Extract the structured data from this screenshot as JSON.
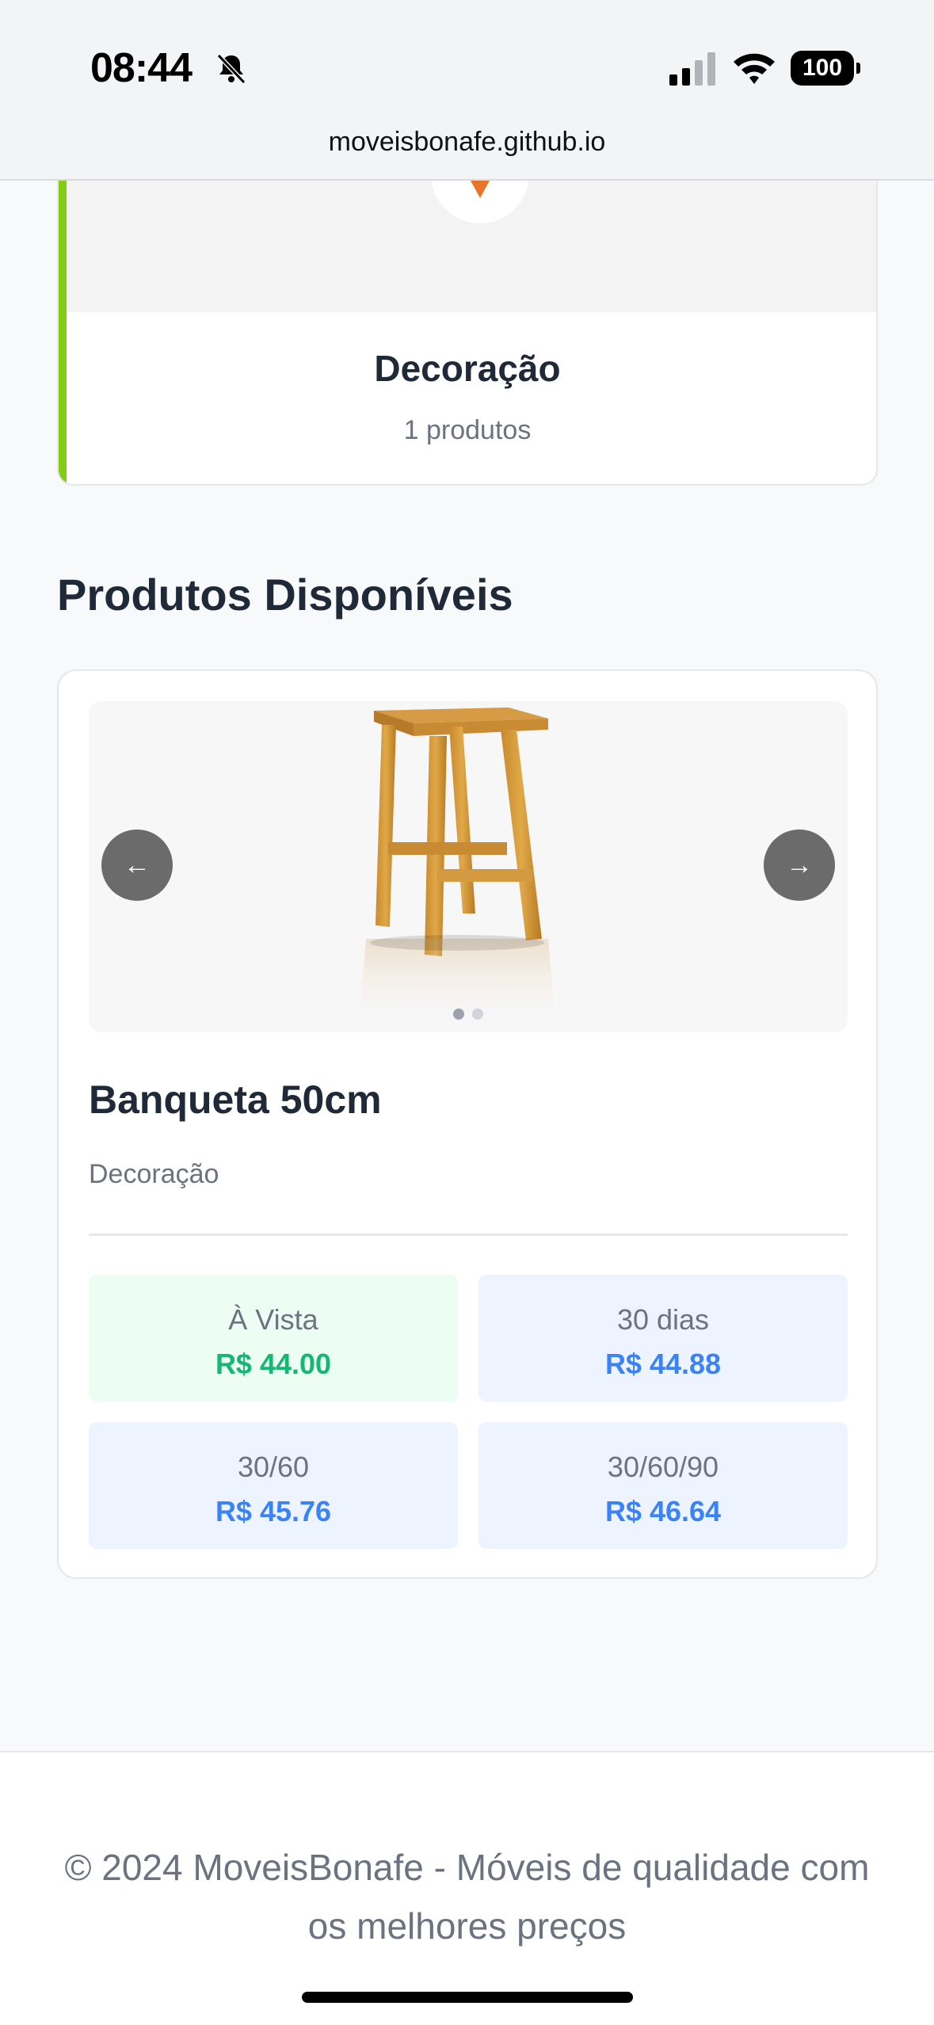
{
  "status_bar": {
    "time": "08:44",
    "battery": "100",
    "url": "moveisbonafe.github.io"
  },
  "category_card": {
    "title": "Decoração",
    "count": "1 produtos",
    "accent_color": "#84cc16"
  },
  "section": {
    "title": "Produtos Disponíveis"
  },
  "product": {
    "name": "Banqueta 50cm",
    "category": "Decoração",
    "prev_icon": "arrow-left-icon",
    "next_icon": "arrow-right-icon",
    "prices": [
      {
        "label": "À Vista",
        "value": "R$ 44.00",
        "color": "#16b673"
      },
      {
        "label": "30 dias",
        "value": "R$ 44.88",
        "color": "#3b82f6"
      },
      {
        "label": "30/60",
        "value": "R$ 45.76",
        "color": "#3b82f6"
      },
      {
        "label": "30/60/90",
        "value": "R$ 46.64",
        "color": "#3b82f6"
      }
    ]
  },
  "footer": {
    "text": "© 2024 MoveisBonafe - Móveis de qualidade com os melhores preços"
  }
}
